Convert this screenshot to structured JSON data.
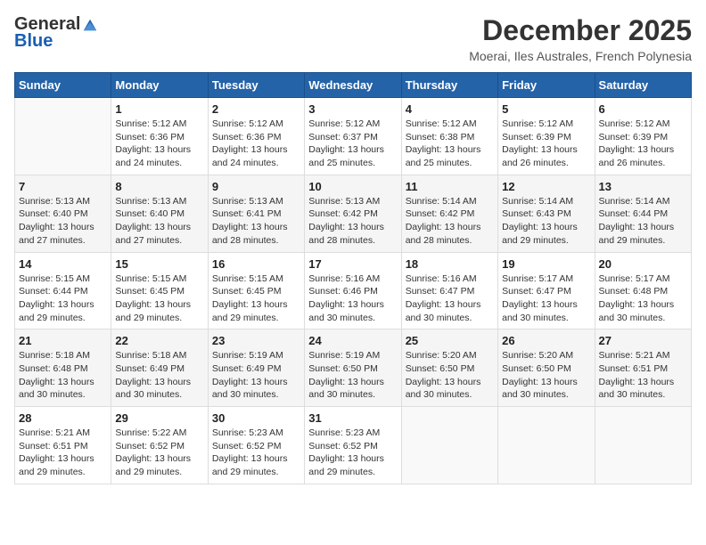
{
  "logo": {
    "general": "General",
    "blue": "Blue"
  },
  "title": "December 2025",
  "subtitle": "Moerai, Iles Australes, French Polynesia",
  "weekdays": [
    "Sunday",
    "Monday",
    "Tuesday",
    "Wednesday",
    "Thursday",
    "Friday",
    "Saturday"
  ],
  "weeks": [
    [
      {
        "day": null
      },
      {
        "day": "1",
        "sunrise": "5:12 AM",
        "sunset": "6:36 PM",
        "daylight": "13 hours and 24 minutes."
      },
      {
        "day": "2",
        "sunrise": "5:12 AM",
        "sunset": "6:36 PM",
        "daylight": "13 hours and 24 minutes."
      },
      {
        "day": "3",
        "sunrise": "5:12 AM",
        "sunset": "6:37 PM",
        "daylight": "13 hours and 25 minutes."
      },
      {
        "day": "4",
        "sunrise": "5:12 AM",
        "sunset": "6:38 PM",
        "daylight": "13 hours and 25 minutes."
      },
      {
        "day": "5",
        "sunrise": "5:12 AM",
        "sunset": "6:39 PM",
        "daylight": "13 hours and 26 minutes."
      },
      {
        "day": "6",
        "sunrise": "5:12 AM",
        "sunset": "6:39 PM",
        "daylight": "13 hours and 26 minutes."
      }
    ],
    [
      {
        "day": "7",
        "sunrise": "5:13 AM",
        "sunset": "6:40 PM",
        "daylight": "13 hours and 27 minutes."
      },
      {
        "day": "8",
        "sunrise": "5:13 AM",
        "sunset": "6:40 PM",
        "daylight": "13 hours and 27 minutes."
      },
      {
        "day": "9",
        "sunrise": "5:13 AM",
        "sunset": "6:41 PM",
        "daylight": "13 hours and 28 minutes."
      },
      {
        "day": "10",
        "sunrise": "5:13 AM",
        "sunset": "6:42 PM",
        "daylight": "13 hours and 28 minutes."
      },
      {
        "day": "11",
        "sunrise": "5:14 AM",
        "sunset": "6:42 PM",
        "daylight": "13 hours and 28 minutes."
      },
      {
        "day": "12",
        "sunrise": "5:14 AM",
        "sunset": "6:43 PM",
        "daylight": "13 hours and 29 minutes."
      },
      {
        "day": "13",
        "sunrise": "5:14 AM",
        "sunset": "6:44 PM",
        "daylight": "13 hours and 29 minutes."
      }
    ],
    [
      {
        "day": "14",
        "sunrise": "5:15 AM",
        "sunset": "6:44 PM",
        "daylight": "13 hours and 29 minutes."
      },
      {
        "day": "15",
        "sunrise": "5:15 AM",
        "sunset": "6:45 PM",
        "daylight": "13 hours and 29 minutes."
      },
      {
        "day": "16",
        "sunrise": "5:15 AM",
        "sunset": "6:45 PM",
        "daylight": "13 hours and 29 minutes."
      },
      {
        "day": "17",
        "sunrise": "5:16 AM",
        "sunset": "6:46 PM",
        "daylight": "13 hours and 30 minutes."
      },
      {
        "day": "18",
        "sunrise": "5:16 AM",
        "sunset": "6:47 PM",
        "daylight": "13 hours and 30 minutes."
      },
      {
        "day": "19",
        "sunrise": "5:17 AM",
        "sunset": "6:47 PM",
        "daylight": "13 hours and 30 minutes."
      },
      {
        "day": "20",
        "sunrise": "5:17 AM",
        "sunset": "6:48 PM",
        "daylight": "13 hours and 30 minutes."
      }
    ],
    [
      {
        "day": "21",
        "sunrise": "5:18 AM",
        "sunset": "6:48 PM",
        "daylight": "13 hours and 30 minutes."
      },
      {
        "day": "22",
        "sunrise": "5:18 AM",
        "sunset": "6:49 PM",
        "daylight": "13 hours and 30 minutes."
      },
      {
        "day": "23",
        "sunrise": "5:19 AM",
        "sunset": "6:49 PM",
        "daylight": "13 hours and 30 minutes."
      },
      {
        "day": "24",
        "sunrise": "5:19 AM",
        "sunset": "6:50 PM",
        "daylight": "13 hours and 30 minutes."
      },
      {
        "day": "25",
        "sunrise": "5:20 AM",
        "sunset": "6:50 PM",
        "daylight": "13 hours and 30 minutes."
      },
      {
        "day": "26",
        "sunrise": "5:20 AM",
        "sunset": "6:50 PM",
        "daylight": "13 hours and 30 minutes."
      },
      {
        "day": "27",
        "sunrise": "5:21 AM",
        "sunset": "6:51 PM",
        "daylight": "13 hours and 30 minutes."
      }
    ],
    [
      {
        "day": "28",
        "sunrise": "5:21 AM",
        "sunset": "6:51 PM",
        "daylight": "13 hours and 29 minutes."
      },
      {
        "day": "29",
        "sunrise": "5:22 AM",
        "sunset": "6:52 PM",
        "daylight": "13 hours and 29 minutes."
      },
      {
        "day": "30",
        "sunrise": "5:23 AM",
        "sunset": "6:52 PM",
        "daylight": "13 hours and 29 minutes."
      },
      {
        "day": "31",
        "sunrise": "5:23 AM",
        "sunset": "6:52 PM",
        "daylight": "13 hours and 29 minutes."
      },
      {
        "day": null
      },
      {
        "day": null
      },
      {
        "day": null
      }
    ]
  ]
}
